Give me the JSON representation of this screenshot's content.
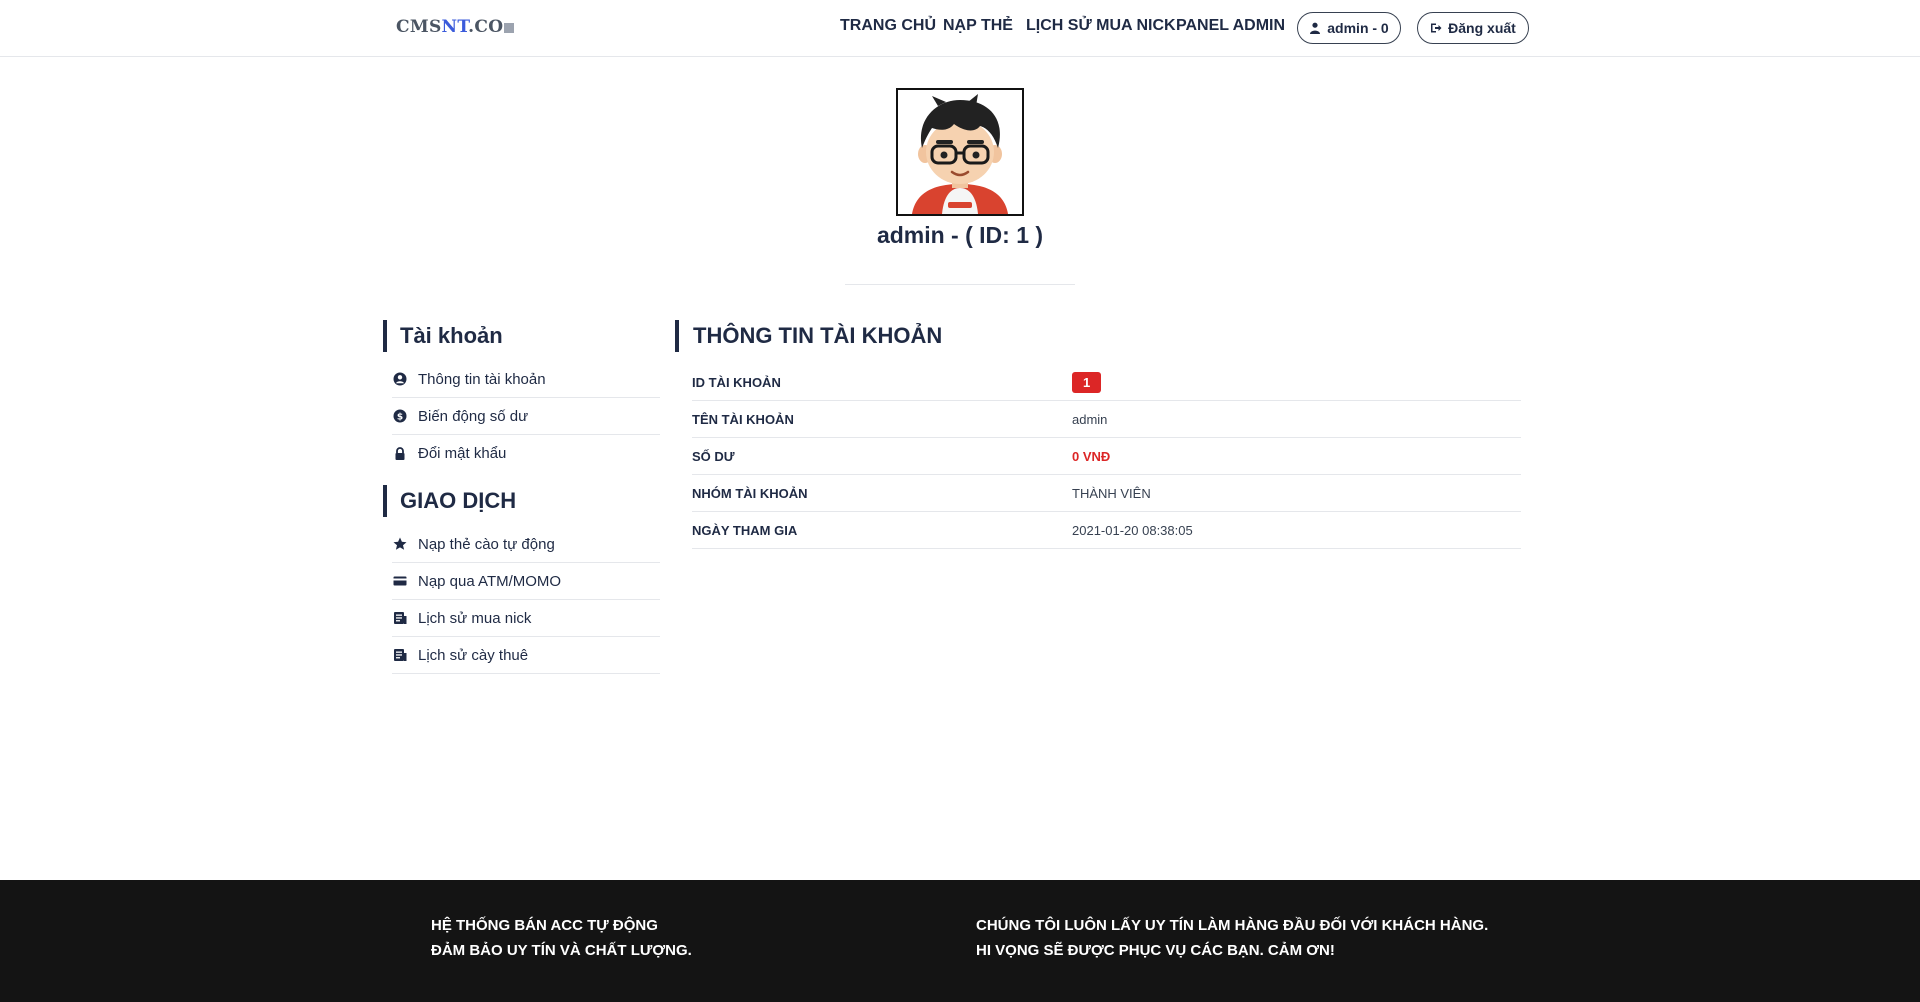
{
  "header": {
    "logo": {
      "part1": "CMS",
      "part2": "NT",
      "part3": ".CO"
    },
    "nav": [
      "TRANG CHỦ",
      "NẠP THẺ",
      "LỊCH SỬ MUA NICK",
      "PANEL ADMIN"
    ],
    "user_button": "admin - 0",
    "logout_button": "Đăng xuất"
  },
  "profile": {
    "name": "admin - ( ID: 1 )"
  },
  "sidebar": {
    "account_title": "Tài khoản",
    "account_items": [
      {
        "label": "Thông tin tài khoản",
        "icon": "user-circle-icon"
      },
      {
        "label": "Biến động số dư",
        "icon": "dollar-circle-icon"
      },
      {
        "label": "Đổi mật khẩu",
        "icon": "lock-icon"
      }
    ],
    "transaction_title": "GIAO DỊCH",
    "transaction_items": [
      {
        "label": "Nạp thẻ cào tự động",
        "icon": "star-icon"
      },
      {
        "label": "Nạp qua ATM/MOMO",
        "icon": "credit-card-icon"
      },
      {
        "label": "Lịch sử mua nick",
        "icon": "receipt-icon"
      },
      {
        "label": "Lịch sử cày thuê",
        "icon": "receipt-icon"
      }
    ]
  },
  "account_info": {
    "title": "THÔNG TIN TÀI KHOẢN",
    "rows": [
      {
        "label": "ID TÀI KHOẢN",
        "value": "1"
      },
      {
        "label": "TÊN TÀI KHOẢN",
        "value": "admin"
      },
      {
        "label": "SỐ DƯ",
        "value": "0 VNĐ"
      },
      {
        "label": "NHÓM TÀI KHOẢN",
        "value": "THÀNH VIÊN"
      },
      {
        "label": "NGÀY THAM GIA",
        "value": "2021-01-20 08:38:05"
      }
    ]
  },
  "footer": {
    "left_line1": "HỆ THỐNG BÁN ACC TỰ ĐỘNG",
    "left_line2": "ĐẢM BẢO UY TÍN VÀ CHẤT LƯỢNG.",
    "right_line1": "CHÚNG TÔI LUÔN LẤY UY TÍN LÀM HÀNG ĐẦU ĐỐI VỚI KHÁCH HÀNG.",
    "right_line2": "HI VỌNG SẼ ĐƯỢC PHỤC VỤ CÁC BẠN. CẢM ƠN!"
  },
  "colors": {
    "primary": "#1f2a44",
    "danger": "#dc2626",
    "footer_bg": "#141414"
  }
}
